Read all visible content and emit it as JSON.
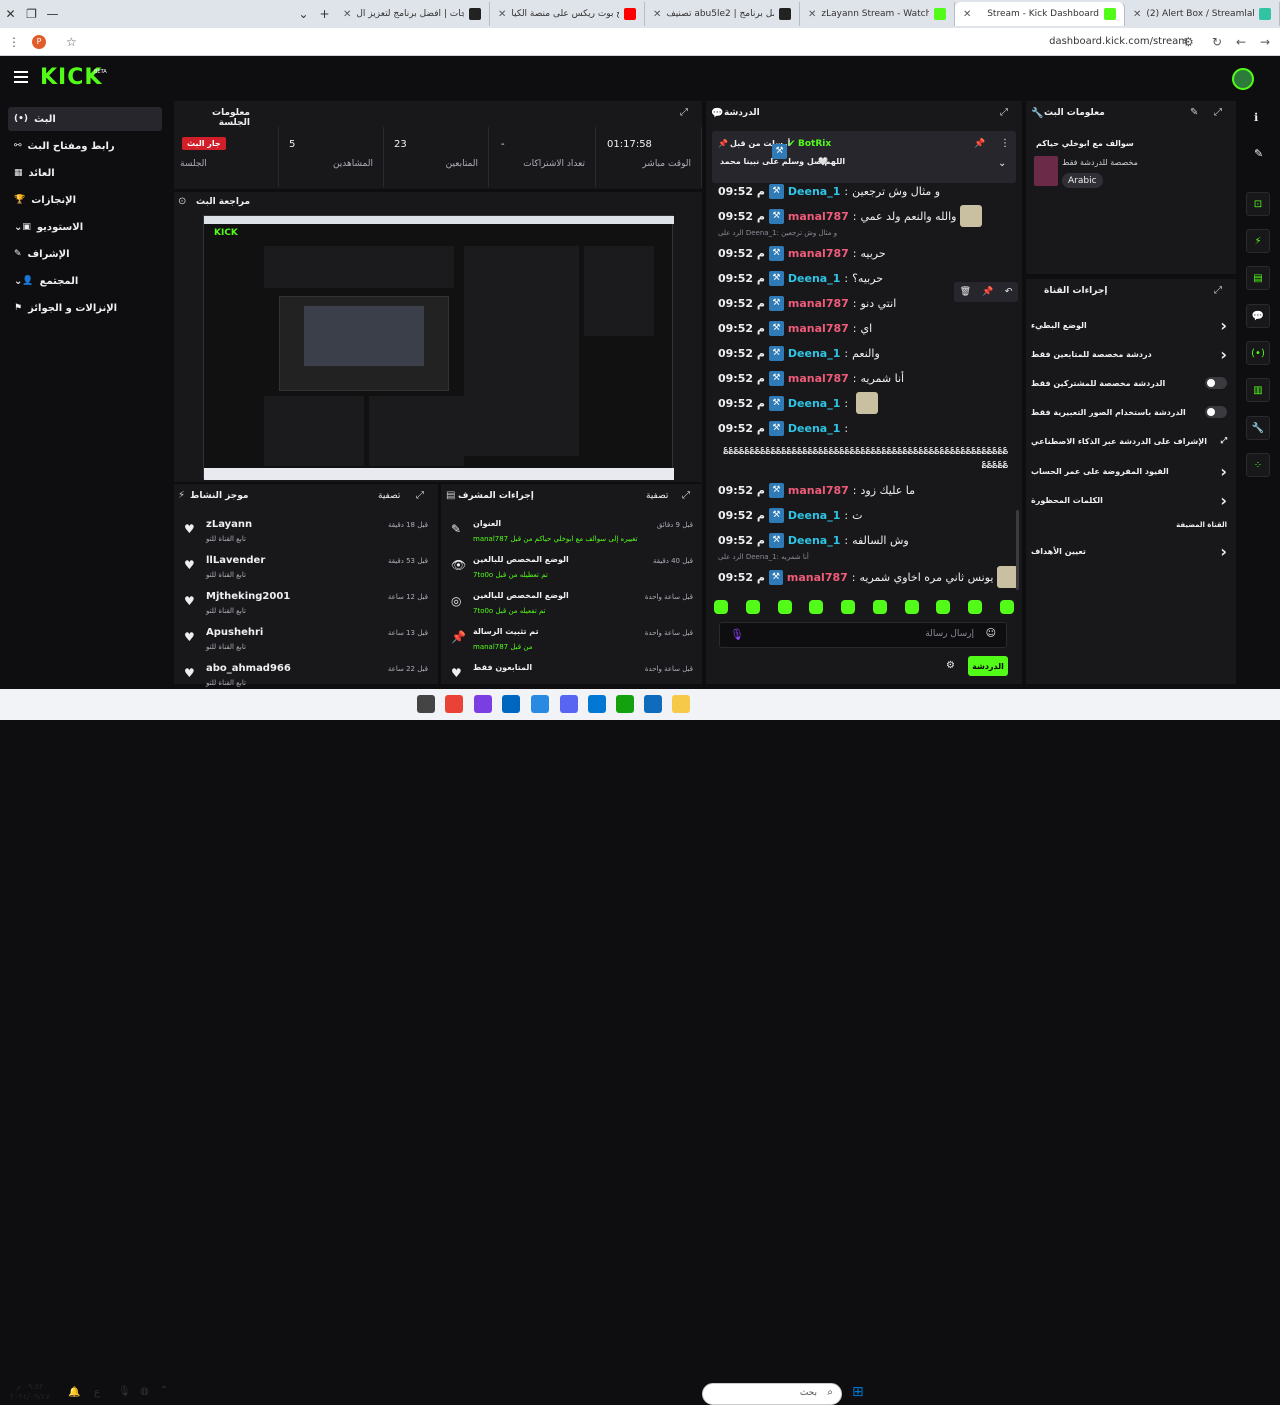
{
  "browser": {
    "tabs": [
      {
        "title": "(2) Alert Box / Streamlabs",
        "color": "#31c3a2"
      },
      {
        "title": "Stream - Kick Dashboard",
        "color": "#53fc18",
        "active": true
      },
      {
        "title": "zLayann Stream - Watch Live o",
        "color": "#53fc18"
      },
      {
        "title": "تصنيف abu5le2 | أفضل برنامج",
        "color": "#222222"
      },
      {
        "title": "شرح بوت ريكس على منصة الكيا...",
        "color": "#ff0000"
      },
      {
        "title": "الويدجات | أفضل برنامج لتعزيز ال",
        "color": "#222222"
      }
    ],
    "url": "dashboard.kick.com/stream"
  },
  "kick": {
    "logo": "KICK",
    "beta": "BETA"
  },
  "nav": {
    "items": [
      {
        "label": "البث",
        "icon": "(•)"
      },
      {
        "label": "رابط ومفتاح البث",
        "icon": "⚯"
      },
      {
        "label": "العائد",
        "icon": "▦"
      },
      {
        "label": "الإنجازات",
        "icon": "🏆"
      },
      {
        "label": "الاستوديو",
        "icon": "▣"
      },
      {
        "label": "الإشراف",
        "icon": "✎"
      },
      {
        "label": "المجتمع",
        "icon": "👤"
      },
      {
        "label": "الإنزالات و الجوائز",
        "icon": "⚑"
      }
    ]
  },
  "session": {
    "title": "معلومات الجلسة",
    "live_badge": "جار البث",
    "items": [
      {
        "label": "الجلسة",
        "value": ""
      },
      {
        "label": "المشاهدين",
        "value": "5"
      },
      {
        "label": "المتابعين",
        "value": "23"
      },
      {
        "label": "تعداد الاشتراكات",
        "value": "-"
      },
      {
        "label": "الوقت مباشر",
        "value": "01:17:58"
      }
    ]
  },
  "preview": {
    "title": "مراجعة البث"
  },
  "activity": {
    "title": "موجز النشاط",
    "filter": "تصفية",
    "items": [
      {
        "name": "zLayann",
        "sub": "تابع القناة للتو",
        "time": "قبل 18 دقيقة"
      },
      {
        "name": "llLavender",
        "sub": "تابع القناة للتو",
        "time": "قبل 53 دقيقة"
      },
      {
        "name": "Mjtheking2001",
        "sub": "تابع القناة للتو",
        "time": "قبل 12 ساعة"
      },
      {
        "name": "Apushehri",
        "sub": "تابع القناة للتو",
        "time": "قبل 13 ساعة"
      },
      {
        "name": "abo_ahmad966",
        "sub": "تابع القناة للتو",
        "time": "قبل 22 ساعة"
      }
    ]
  },
  "modactions": {
    "title": "إجراءات المشرف",
    "filter": "تصفية",
    "items": [
      {
        "name": "العنوان",
        "sub": "manal787 تم تغييره إلى سوالف مع ابوخلي حياكم من قبل",
        "time": "قبل 9 دقائق",
        "icon": "✎"
      },
      {
        "name": "الوضع المخصص للبالغين",
        "sub": "7to0o تم تعطيله من قبل",
        "time": "قبل 40 دقيقة",
        "icon": "👁"
      },
      {
        "name": "الوضع المخصص للبالغين",
        "sub": "7to0o تم تفعيله من قبل",
        "time": "قبل ساعة واحدة",
        "icon": "◎"
      },
      {
        "name": "تم تثبيت الرسالة",
        "sub": "manal787 من قبل",
        "time": "قبل ساعة واحدة",
        "icon": "📌"
      },
      {
        "name": "المتابعون فقط",
        "sub": "",
        "time": "قبل ساعة واحدة",
        "icon": "♥"
      }
    ]
  },
  "chat": {
    "title": "الدردشة",
    "pinned": {
      "user": "BotRix",
      "label": "أرسلت من قبل",
      "text": "اللهم صل وسلم على نبينا محمد"
    },
    "messages": [
      {
        "time": "09:52 م",
        "user": "Deena_1",
        "color": "#2ec5e6",
        "text": "و مثال وش ترجعين"
      },
      {
        "time": "09:52 م",
        "user": "manal787",
        "color": "#f05b7a",
        "text": "والله والنعم ولد عمي",
        "emote": true
      },
      {
        "reply": "الرد على Deena_1: و مثال وش ترجعين"
      },
      {
        "time": "09:52 م",
        "user": "manal787",
        "color": "#f05b7a",
        "text": "حربيه"
      },
      {
        "time": "09:52 م",
        "user": "Deena_1",
        "color": "#2ec5e6",
        "text": "حربيه؟"
      },
      {
        "time": "09:52 م",
        "user": "manal787",
        "color": "#f05b7a",
        "text": "انتي دنو"
      },
      {
        "time": "09:52 م",
        "user": "manal787",
        "color": "#f05b7a",
        "text": "اي"
      },
      {
        "time": "09:52 م",
        "user": "Deena_1",
        "color": "#2ec5e6",
        "text": "والنعم"
      },
      {
        "time": "09:52 م",
        "user": "manal787",
        "color": "#f05b7a",
        "text": "أنا شمريه"
      },
      {
        "time": "09:52 م",
        "user": "Deena_1",
        "color": "#2ec5e6",
        "text": "",
        "emote": true
      },
      {
        "time": "09:52 م",
        "user": "Deena_1",
        "color": "#2ec5e6",
        "text": ""
      },
      {
        "time": "09:52 م",
        "user": "manal787",
        "color": "#f05b7a",
        "text": "ما عليك زود"
      },
      {
        "time": "09:52 م",
        "user": "Deena_1",
        "color": "#2ec5e6",
        "text": "ت"
      },
      {
        "time": "09:52 م",
        "user": "Deena_1",
        "color": "#2ec5e6",
        "text": "وش السالفه"
      },
      {
        "reply": "الرد على Deena_1: أنا شمريه"
      },
      {
        "time": "09:52 م",
        "user": "manal787",
        "color": "#f05b7a",
        "text": "يونس ثاني مره اخاوي شمريه",
        "emote": true
      }
    ],
    "long_text": "؏؏؏؏؏؏؏؏؏؏؏؏؏؏؏؏؏؏؏؏؏؏؏؏؏؏؏؏؏؏؏؏؏؏؏؏؏؏؏؏؏؏؏؏؏؏؏؏؏؏؏؏؏؏؏؏؏؏؏",
    "input_placeholder": "إرسال رسالة",
    "send_label": "الدردشة"
  },
  "streaminfo": {
    "title": "معلومات البث",
    "stream_title": "سوالف مع ابوخلي حياكم",
    "category": "مخصصة للدردشة فقط",
    "tag": "Arabic"
  },
  "channel": {
    "title": "إجراءات القناة",
    "items": [
      {
        "label": "الوضع البطيء",
        "type": "chevron"
      },
      {
        "label": "دردشة مخصصة للمتابعين فقط",
        "type": "chevron"
      },
      {
        "label": "الدردشة مخصصة للمشتركين فقط",
        "type": "toggle"
      },
      {
        "label": "الدردشة باستخدام الصور التعبيرية فقط",
        "type": "toggle"
      },
      {
        "label": "الإشراف على الدردشة عبر الذكاء الاصطناعي",
        "type": "ext"
      },
      {
        "label": "القيود المفروضة على عمر الحساب",
        "type": "chevron"
      },
      {
        "label": "الكلمات المحظورة",
        "type": "chevron"
      },
      {
        "label": "القناة المضيفة",
        "type": "none"
      },
      {
        "label": "تعيين الأهداف",
        "type": "chevron"
      }
    ]
  },
  "taskbar": {
    "time": "٠٩:٥٣ م",
    "date": "٢٠٢٤/٠٩/٤٧",
    "search": "بحث",
    "lang": "ع"
  }
}
